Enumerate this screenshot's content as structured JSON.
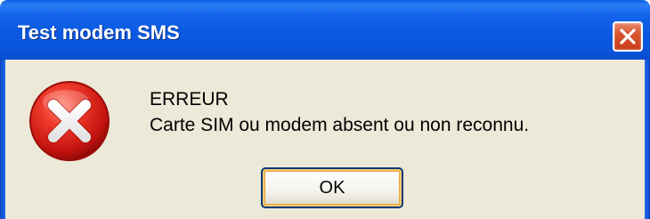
{
  "window": {
    "title": "Test modem SMS",
    "close_icon": "close-icon"
  },
  "dialog": {
    "icon": "error-icon",
    "message_line1": "ERREUR",
    "message_line2": "Carte SIM ou modem absent ou non reconnu.",
    "ok_label": "OK"
  },
  "colors": {
    "titlebar": "#0a55db",
    "dialog_background": "#ece9d8",
    "close_button": "#d9532f",
    "error_icon": "#d3191c"
  }
}
